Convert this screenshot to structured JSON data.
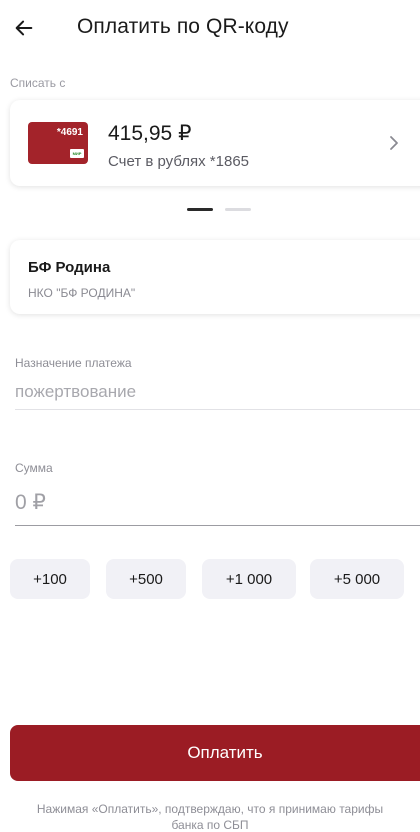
{
  "header": {
    "title": "Оплатить по QR-коду"
  },
  "debit": {
    "label": "Списать с",
    "card_number": "*4691",
    "card_system": "МИР",
    "balance": "415,95 ₽",
    "account": "Счет в рублях *1865"
  },
  "pager": {
    "total": 2,
    "active": 1
  },
  "recipient": {
    "name": "БФ Родина",
    "organization": "НКО \"БФ РОДИНА\""
  },
  "purpose": {
    "label": "Назначение платежа",
    "placeholder": "пожертвование",
    "value": ""
  },
  "amount": {
    "label": "Сумма",
    "placeholder": "0 ₽",
    "value": ""
  },
  "quick_amounts": [
    "+100",
    "+500",
    "+1 000",
    "+5 000"
  ],
  "pay_button": "Оплатить",
  "disclaimer": "Нажимая «Оплатить», подтверждаю, что я принимаю тарифы банка по СБП",
  "colors": {
    "accent": "#9b1c24",
    "card": "#a3232a",
    "chip_bg": "#f1f1f6"
  },
  "icons": {
    "back": "arrow-left-icon",
    "chevron": "chevron-right-icon"
  }
}
